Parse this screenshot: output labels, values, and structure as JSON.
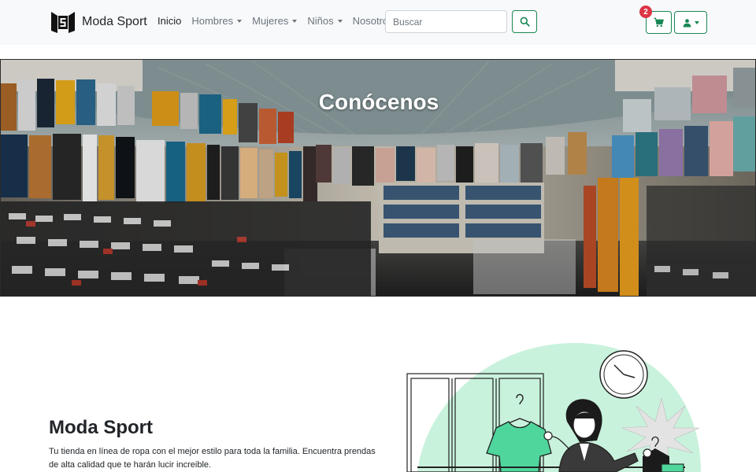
{
  "brand": {
    "name": "Moda Sport",
    "logo_icon": "moda-sport-logo-icon"
  },
  "nav": {
    "items": [
      {
        "label": "Inicio",
        "active": true,
        "dropdown": false
      },
      {
        "label": "Hombres",
        "active": false,
        "dropdown": true
      },
      {
        "label": "Mujeres",
        "active": false,
        "dropdown": true
      },
      {
        "label": "Niños",
        "active": false,
        "dropdown": true
      },
      {
        "label": "Nosotros",
        "active": false,
        "dropdown": false
      }
    ]
  },
  "search": {
    "placeholder": "Buscar",
    "value": "",
    "button_icon": "search-icon"
  },
  "cart": {
    "count": "2",
    "icon": "cart-icon"
  },
  "user": {
    "icon": "user-icon"
  },
  "hero": {
    "title": "Conócenos"
  },
  "about": {
    "title": "Moda Sport",
    "text": "Tu tienda en línea de ropa con el mejor estilo para toda la familia. Encuentra prendas de alta calidad que te harán lucir increible."
  },
  "colors": {
    "accent": "#198754",
    "badge": "#dc3545",
    "navbar_bg": "#f8f9fa",
    "illustration_blob": "#c9f2dc",
    "illustration_green": "#4fd69c"
  }
}
